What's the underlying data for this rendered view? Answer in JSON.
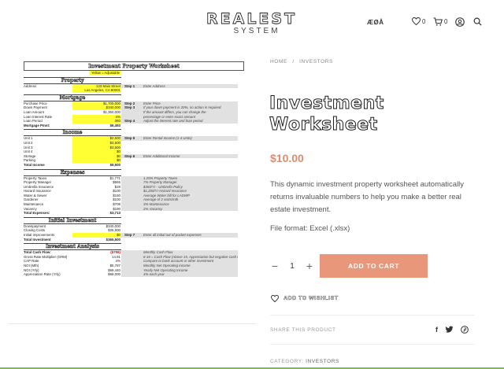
{
  "header": {
    "logo_line1": "REALEST",
    "logo_line2": "SYSTEM",
    "language": "ÆØÅ",
    "wishlist_count": "0",
    "cart_count": "0",
    "icons": [
      "heart-icon",
      "cart-icon",
      "account-icon",
      "search-icon"
    ]
  },
  "worksheet": {
    "title": "Investment Property Worksheet",
    "adjustable_key": "Yellow = Adjustable",
    "sections": [
      {
        "heading": "Property",
        "rows": [
          {
            "label": "Address",
            "value": "123 Main Street",
            "yellow": true,
            "step": "Step 1",
            "note": "Enter Address"
          },
          {
            "label": "",
            "value": "Los Angeles, CA 90001",
            "yellow": true,
            "step": "",
            "note": ""
          }
        ]
      },
      {
        "heading": "Mortgage",
        "rows": [
          {
            "label": "Purchase Price",
            "value": "$1,700,000",
            "yellow": true,
            "step": "Step 2",
            "note": "Enter Price"
          },
          {
            "label": "Down Payment",
            "value": "$340,000",
            "yellow": true,
            "step": "Step 3",
            "note": "If your down payment is 20%, no action is required."
          },
          {
            "label": "Loan Amount",
            "value": "$1,360,000",
            "yellow": false,
            "step": "",
            "note": "If the amount differs, you can change the"
          },
          {
            "label": "Loan Interest Rate",
            "value": "4%",
            "yellow": true,
            "step": "",
            "note": "percentage or enter exact amount"
          },
          {
            "label": "Loan Period",
            "value": "360",
            "yellow": true,
            "step": "Step 4",
            "note": "Adjust the interest rate and loan period"
          },
          {
            "label": "Mortgage Pmnt:",
            "value": "$6,493",
            "yellow": false,
            "bold": true,
            "step": "",
            "note": ""
          }
        ]
      },
      {
        "heading": "Income",
        "rows": [
          {
            "label": "Unit 1",
            "value": "$2,500",
            "yellow": true,
            "step": "Step 5",
            "note": "Enter Rental Income (1-4 Units)"
          },
          {
            "label": "Unit 2",
            "value": "$3,500",
            "yellow": true,
            "step": "",
            "note": ""
          },
          {
            "label": "Unit 3",
            "value": "$3,500",
            "yellow": true,
            "step": "",
            "note": ""
          },
          {
            "label": "Unit 4",
            "value": "$0",
            "yellow": true,
            "step": "",
            "note": ""
          },
          {
            "label": "Storage",
            "value": "$0",
            "yellow": true,
            "step": "Step 6",
            "note": "Enter Additional Income"
          },
          {
            "label": "Parking",
            "value": "$0",
            "yellow": true,
            "step": "",
            "note": ""
          },
          {
            "label": "Total Income",
            "value": "$9,500",
            "yellow": false,
            "bold": true,
            "step": "",
            "note": ""
          }
        ]
      },
      {
        "heading": "Expenses",
        "rows": [
          {
            "label": "Property Taxes",
            "value": "$1,771",
            "yellow": false,
            "step": "",
            "note": "1.25% Property Taxes"
          },
          {
            "label": "Property Manager",
            "value": "$665",
            "yellow": false,
            "step": "",
            "note": "7% Property Manager"
          },
          {
            "label": "Umbrella Insurance",
            "value": "$29",
            "yellow": false,
            "step": "",
            "note": "$350/Yr - Umbrella Policy"
          },
          {
            "label": "Hazard Insurance",
            "value": "$100",
            "yellow": false,
            "step": "",
            "note": "$1,200/Yr Hazard Insurance"
          },
          {
            "label": "Water & Sewer",
            "value": "$150",
            "yellow": false,
            "step": "",
            "note": "Average Water bill for LADWP"
          },
          {
            "label": "Gardener",
            "value": "$100",
            "yellow": false,
            "step": "",
            "note": "Average of 2 visits/mth"
          },
          {
            "label": "Maintenance",
            "value": "$708",
            "yellow": false,
            "step": "",
            "note": "3% Maintenance"
          },
          {
            "label": "Vacancy",
            "value": "$190",
            "yellow": false,
            "step": "",
            "note": "2% Vacancy"
          },
          {
            "label": "Total Expenses:",
            "value": "$3,713",
            "yellow": false,
            "bold": true,
            "step": "",
            "note": ""
          }
        ]
      },
      {
        "heading": "Initial Investment",
        "rows": [
          {
            "label": "Downpayment",
            "value": "$340,000",
            "yellow": false,
            "step": "",
            "note": ""
          },
          {
            "label": "Closing Costs",
            "value": "$25,500",
            "yellow": false,
            "step": "",
            "note": ""
          },
          {
            "label": "Initial Improvements",
            "value": "$0",
            "yellow": true,
            "step": "Step 7",
            "note": "Enter all initial out of pocket expenses"
          },
          {
            "label": "Total Investment",
            "value": "$365,500",
            "yellow": false,
            "bold": true,
            "step": "",
            "note": ""
          }
        ]
      },
      {
        "heading": "Investment Analysis",
        "rows": [
          {
            "label": "Total Cash Flow:",
            "value": "($706)",
            "yellow": false,
            "bold": true,
            "red": true,
            "step": "",
            "note": "Monthly Cash Flow"
          },
          {
            "label": "Gross Rate Multiplier (GRM)",
            "value": "14.91",
            "yellow": false,
            "step": "",
            "note": "8-16 = Cash Flow (Above 15, Appreciation but negative cash flow)"
          },
          {
            "label": "CAP Rate",
            "value": "4%",
            "yellow": false,
            "step": "",
            "note": "Compare to bank account or other investment"
          },
          {
            "label": "NOI (Mth)",
            "value": "$5,787",
            "yellow": false,
            "step": "",
            "note": "Monthly Net Operating Income"
          },
          {
            "label": "NOI (Yrly)",
            "value": "$69,440",
            "yellow": false,
            "step": "",
            "note": "Yearly Net Operating Income"
          },
          {
            "label": "Appreciation Rate (Yrly)",
            "value": "$68,000",
            "yellow": false,
            "step": "",
            "note": "4% each year"
          }
        ]
      }
    ]
  },
  "product": {
    "breadcrumb": [
      "HOME",
      "/",
      "INVESTORS"
    ],
    "title": "Investment Worksheet",
    "price": "$10.00",
    "description": "This dynamic investment property worksheet automatically returns invaluable numbers to help you make a better real estate investment.",
    "file_format": "File format: Excel (.xlsx)",
    "quantity": "1",
    "minus": "−",
    "plus": "+",
    "add_to_cart": "ADD TO CART",
    "wishlist": "ADD TO WISHLIST",
    "share_label": "SHARE THIS PRODUCT",
    "category_label": "CATEGORY:",
    "category_value": "INVESTORS"
  },
  "colors": {
    "accent": "#e8977b",
    "price": "#e08a6e",
    "highlight": "#ffff33"
  }
}
